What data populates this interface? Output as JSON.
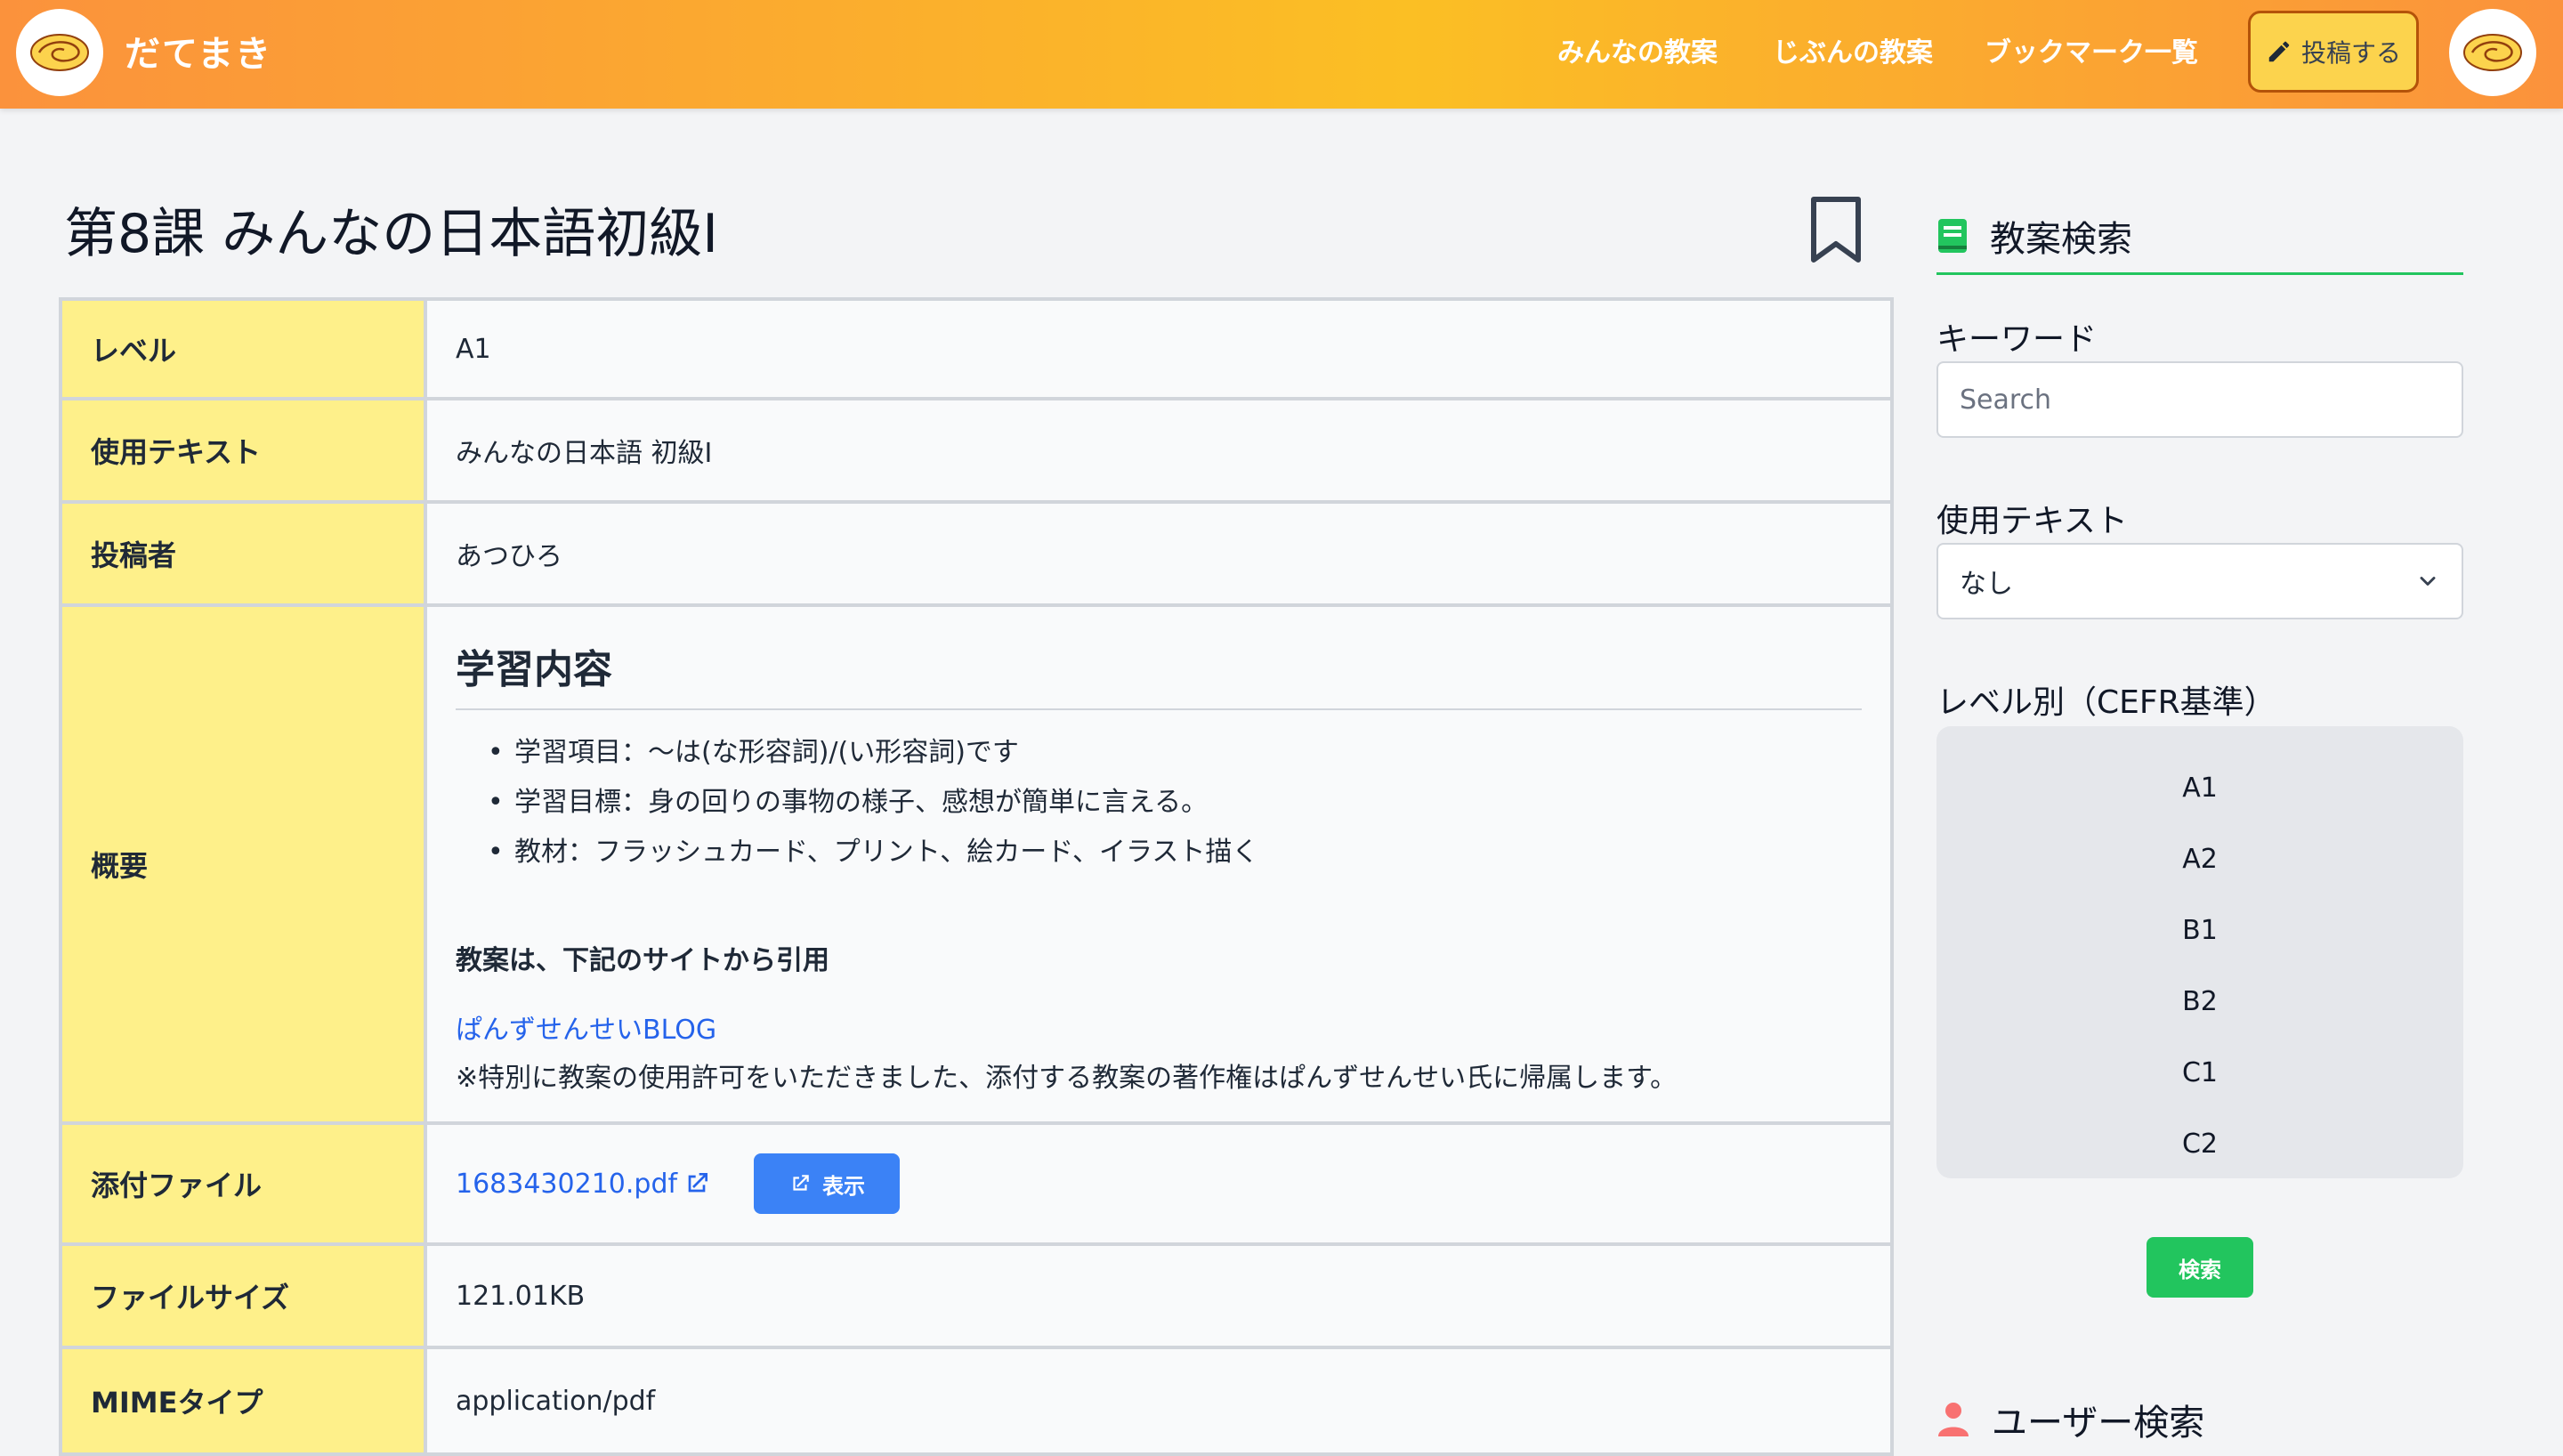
{
  "header": {
    "brand": "だてまき",
    "nav": [
      "みんなの教案",
      "じぶんの教案",
      "ブックマーク一覧"
    ],
    "post_label": "投稿する"
  },
  "page": {
    "title": "第8課 みんなの日本語初級I"
  },
  "details": {
    "level_label": "レベル",
    "level_value": "A1",
    "text_label": "使用テキスト",
    "text_value": "みんなの日本語 初級I",
    "author_label": "投稿者",
    "author_value": "あつひろ",
    "summary_label": "概要",
    "summary": {
      "heading": "学習内容",
      "items": [
        "学習項目：〜は(な形容詞)/(い形容詞)です",
        "学習目標：身の回りの事物の様子、感想が簡単に言える。",
        "教材：フラッシュカード、プリント、絵カード、イラスト描く"
      ],
      "cite_heading": "教案は、下記のサイトから引用",
      "blog_link": "ぱんずせんせいBLOG",
      "notice": "※特別に教案の使用許可をいただきました、添付する教案の著作権はぱんずせんせい氏に帰属します。"
    },
    "file_label": "添付ファイル",
    "file_name": "1683430210.pdf",
    "view_label": "表示",
    "size_label": "ファイルサイズ",
    "size_value": "121.01KB",
    "mime_label": "MIMEタイプ",
    "mime_value": "application/pdf"
  },
  "sidebar": {
    "search_title": "教案検索",
    "keyword_label": "キーワード",
    "keyword_placeholder": "Search",
    "text_label": "使用テキスト",
    "text_selected": "なし",
    "level_label": "レベル別（CEFR基準）",
    "levels": [
      "A1",
      "A2",
      "B1",
      "B2",
      "C1",
      "C2"
    ],
    "search_button": "検索",
    "user_search_title": "ユーザー検索"
  },
  "colors": {
    "header_start": "#fb923c",
    "header_mid": "#fbbf24",
    "label_bg": "#fef08a",
    "link": "#2563eb",
    "primary_button": "#3b82f6",
    "search_button": "#22c55e"
  }
}
